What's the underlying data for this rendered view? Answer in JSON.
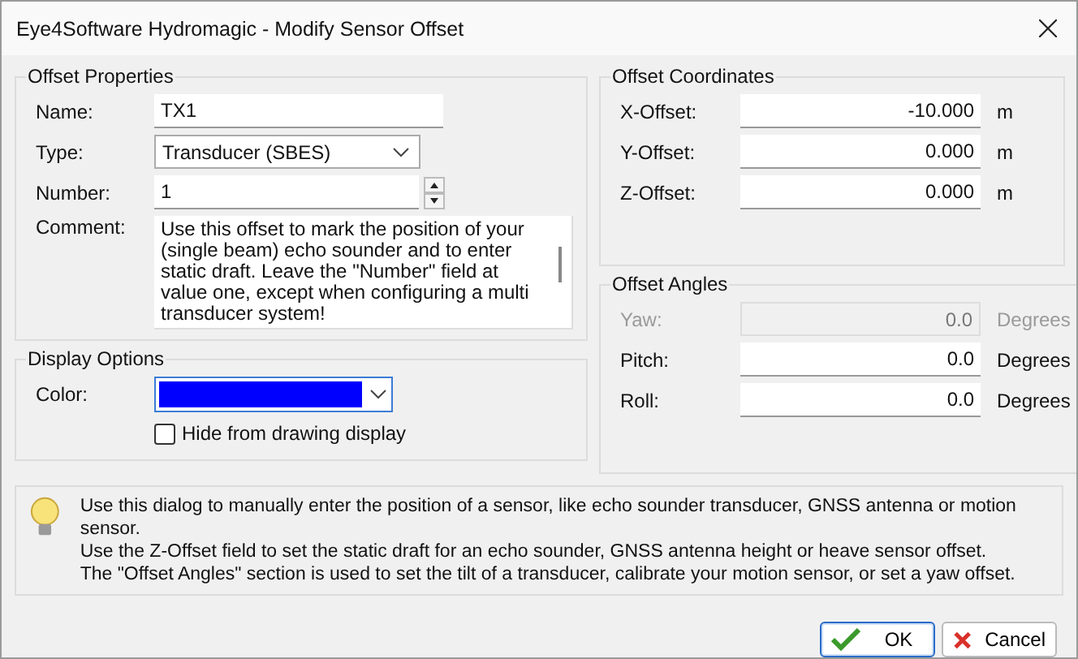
{
  "window": {
    "title": "Eye4Software Hydromagic - Modify Sensor Offset"
  },
  "offset_properties": {
    "title": "Offset Properties",
    "name": {
      "label": "Name:",
      "value": "TX1"
    },
    "type": {
      "label": "Type:",
      "value": "Transducer (SBES)"
    },
    "number": {
      "label": "Number:",
      "value": "1"
    },
    "comment": {
      "label": "Comment:",
      "value": "Use this offset to mark the position of your (single beam) echo sounder and to enter static draft. Leave the \"Number\" field at value one, except when configuring a multi transducer system!"
    }
  },
  "display_options": {
    "title": "Display Options",
    "color_label": "Color:",
    "color": "#0000ff",
    "hide_checkbox": {
      "label": "Hide from drawing display",
      "checked": false
    }
  },
  "offset_coordinates": {
    "title": "Offset Coordinates",
    "fields": [
      {
        "label": "X-Offset:",
        "value": "-10.000",
        "unit": "m",
        "disabled": false
      },
      {
        "label": "Y-Offset:",
        "value": "0.000",
        "unit": "m",
        "disabled": false
      },
      {
        "label": "Z-Offset:",
        "value": "0.000",
        "unit": "m",
        "disabled": false
      }
    ]
  },
  "offset_angles": {
    "title": "Offset Angles",
    "fields": [
      {
        "label": "Yaw:",
        "value": "0.0",
        "unit": "Degrees",
        "disabled": true
      },
      {
        "label": "Pitch:",
        "value": "0.0",
        "unit": "Degrees",
        "disabled": false
      },
      {
        "label": "Roll:",
        "value": "0.0",
        "unit": "Degrees",
        "disabled": false
      }
    ]
  },
  "info": {
    "lines": [
      "Use this dialog to manually enter the position of a sensor, like echo sounder transducer, GNSS antenna or motion sensor.",
      "Use the Z-Offset field to set the static draft for an echo sounder, GNSS antenna height or heave sensor offset.",
      "The \"Offset Angles\" section is used to set the tilt of a transducer, calibrate your motion sensor, or set a yaw offset."
    ]
  },
  "buttons": [
    {
      "label": "OK",
      "kind": "ok",
      "selected": true
    },
    {
      "label": "Cancel",
      "kind": "cancel",
      "selected": false
    }
  ]
}
